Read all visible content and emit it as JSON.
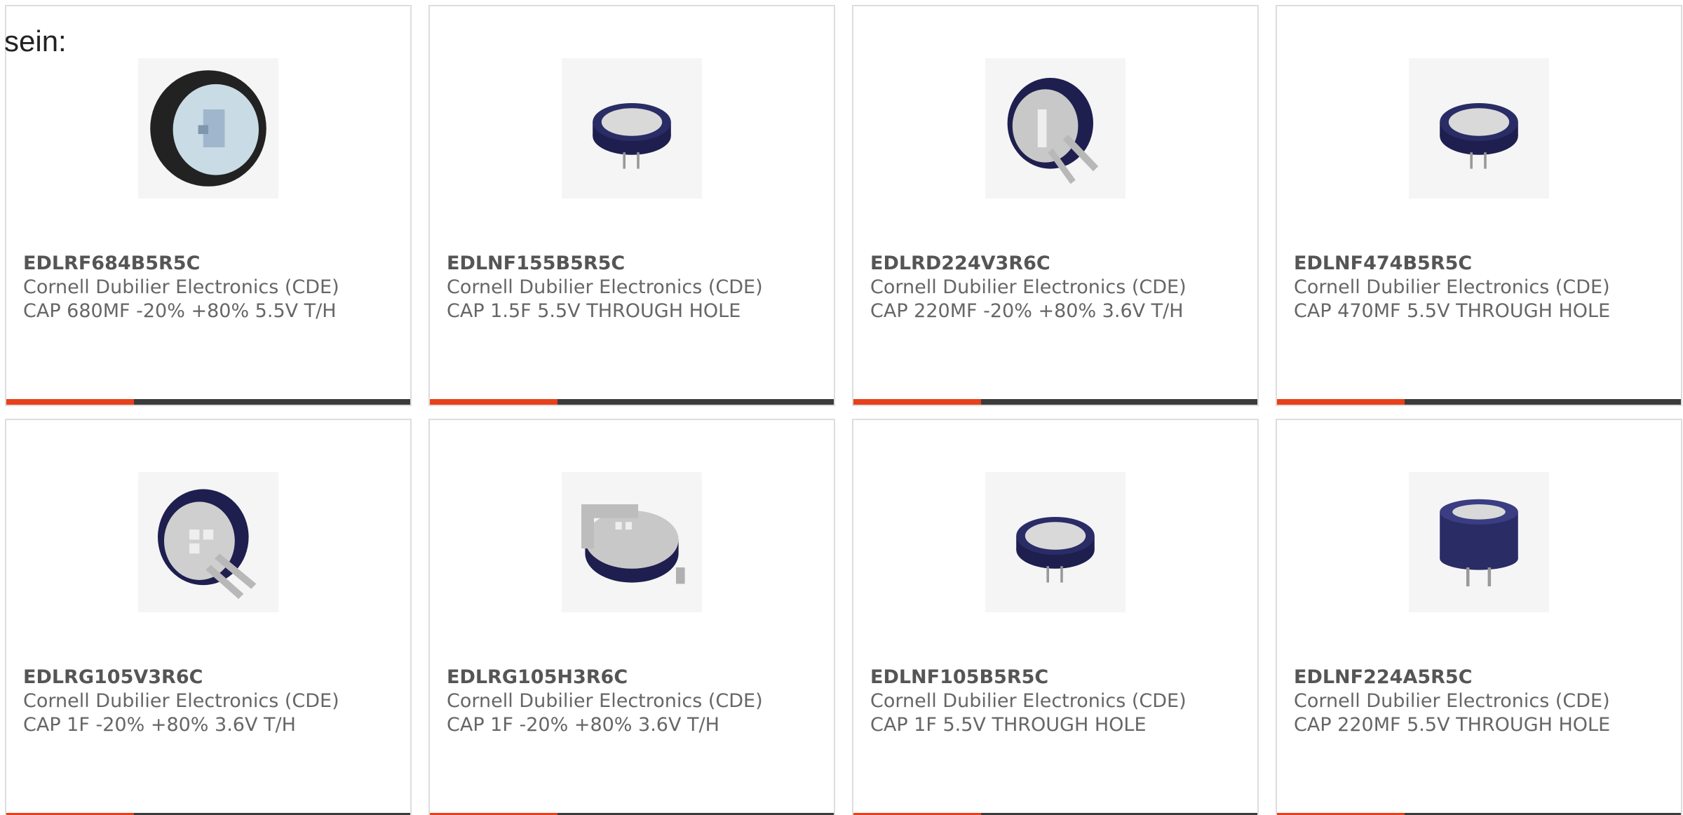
{
  "intro": {
    "text": "sein:"
  },
  "colors": {
    "accent": "#e8401a",
    "bar": "#3b3b3b",
    "cap_body": "#1e1f4f"
  },
  "products": [
    {
      "part_number": "EDLRF684B5R5C",
      "manufacturer": "Cornell Dubilier Electronics (CDE)",
      "description": "CAP 680MF -20% +80% 5.5V T/H",
      "image_icon": "black-radial-supercap-icon"
    },
    {
      "part_number": "EDLNF155B5R5C",
      "manufacturer": "Cornell Dubilier Electronics (CDE)",
      "description": "CAP 1.5F 5.5V THROUGH HOLE",
      "image_icon": "blue-coin-supercap-icon"
    },
    {
      "part_number": "EDLRD224V3R6C",
      "manufacturer": "Cornell Dubilier Electronics (CDE)",
      "description": "CAP 220MF -20% +80% 3.6V T/H",
      "image_icon": "blue-coin-supercap-leads-icon"
    },
    {
      "part_number": "EDLNF474B5R5C",
      "manufacturer": "Cornell Dubilier Electronics (CDE)",
      "description": "CAP 470MF 5.5V THROUGH HOLE",
      "image_icon": "blue-coin-supercap-icon"
    },
    {
      "part_number": "EDLRG105V3R6C",
      "manufacturer": "Cornell Dubilier Electronics (CDE)",
      "description": "CAP 1F -20% +80% 3.6V T/H",
      "image_icon": "blue-coin-supercap-leads-icon"
    },
    {
      "part_number": "EDLRG105H3R6C",
      "manufacturer": "Cornell Dubilier Electronics (CDE)",
      "description": "CAP 1F -20% +80% 3.6V T/H",
      "image_icon": "blue-coin-supercap-tab-icon"
    },
    {
      "part_number": "EDLNF105B5R5C",
      "manufacturer": "Cornell Dubilier Electronics (CDE)",
      "description": "CAP 1F 5.5V THROUGH HOLE",
      "image_icon": "blue-coin-supercap-icon"
    },
    {
      "part_number": "EDLNF224A5R5C",
      "manufacturer": "Cornell Dubilier Electronics (CDE)",
      "description": "CAP 220MF 5.5V THROUGH HOLE",
      "image_icon": "blue-coin-supercap-upright-icon"
    }
  ]
}
